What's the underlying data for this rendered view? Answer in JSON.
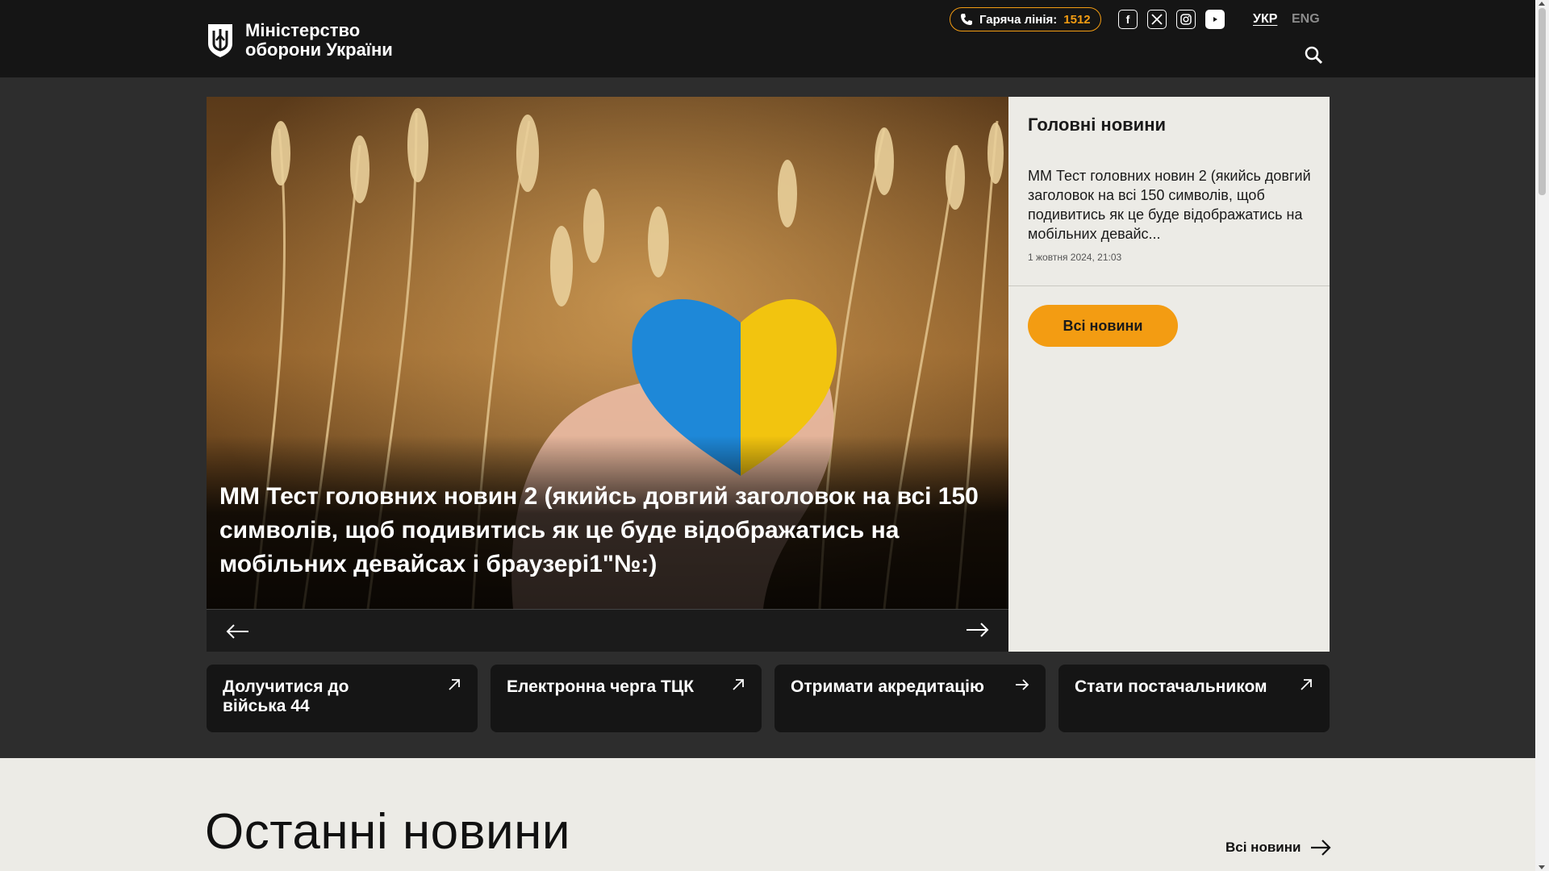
{
  "header": {
    "logo_line1": "Міністерство",
    "logo_line2": "оборони України",
    "hotline_label": "Гаряча лінія:",
    "hotline_number": "1512",
    "socials": [
      "facebook-icon",
      "x-twitter-icon",
      "instagram-icon",
      "youtube-icon"
    ],
    "lang_active": "УКР",
    "lang_other": "ENG",
    "accent": "#f39c12"
  },
  "hero": {
    "title": "ММ Тест головних новин 2 (якийсь довгий заголовок на всі 150 символів, щоб подивитись як це буде відображатись на мобільних девайсах і браузері1\"№:)"
  },
  "aside": {
    "heading": "Головні новини",
    "item_text": "ММ Тест головних новин 2 (якийсь довгий заголовок на всі 150 символів, щоб подивитись як це буде відображатись на мобільних девайс...",
    "item_date": "1 жовтня 2024, 21:03",
    "button": "Всі новини"
  },
  "quick_links": [
    {
      "label": "Долучитися до війська 44",
      "icon": "arrow-up-right-icon"
    },
    {
      "label": "Електронна черга ТЦК",
      "icon": "arrow-up-right-icon"
    },
    {
      "label": "Отримати акредитацію",
      "icon": "arrow-right-icon"
    },
    {
      "label": "Стати постачальником",
      "icon": "arrow-up-right-icon"
    }
  ],
  "latest": {
    "heading": "Останні новини",
    "all_link": "Всі новини"
  }
}
